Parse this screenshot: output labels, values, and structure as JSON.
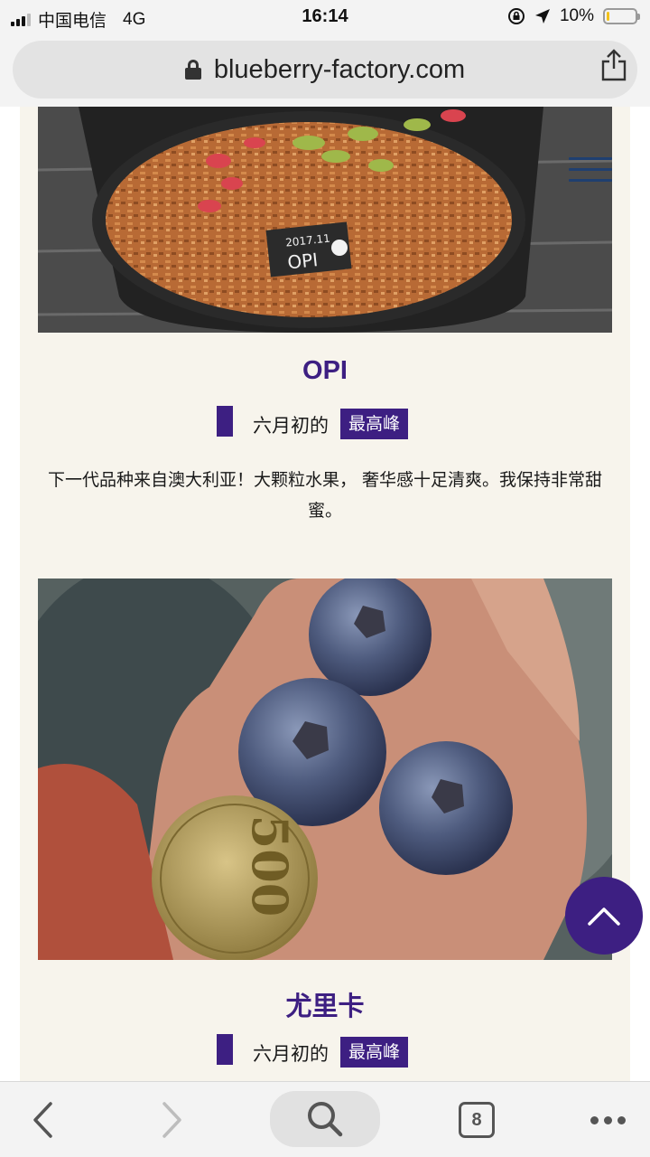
{
  "status_bar": {
    "carrier": "中国电信",
    "network": "4G",
    "time": "16:14",
    "battery_percent": "10%",
    "battery_level": 0.1
  },
  "browser": {
    "url": "blueberry-factory.com",
    "tab_count": "8"
  },
  "varieties": [
    {
      "name": "OPI",
      "label_text": "2017.11",
      "label_name": "OPI",
      "peak_prefix": "六月初的",
      "peak_badge": "最高峰",
      "description": "下一代品种来自澳大利亚！大颗粒水果， 奢华感十足清爽。我保持非常甜蜜。"
    },
    {
      "name": "尤里卡",
      "coin_value": "500",
      "peak_prefix": "六月初的",
      "peak_badge": "最高峰"
    }
  ],
  "colors": {
    "accent": "#3d1f82",
    "card_background": "#f7f4ec",
    "menu_icon": "#1f3f70"
  },
  "icons": {
    "menu": "hamburger-menu-icon",
    "scroll_top": "chevron-up-icon",
    "share": "share-icon",
    "lock": "lock-icon",
    "back": "chevron-left-icon",
    "forward": "chevron-right-icon",
    "search": "search-icon",
    "more": "more-dots-icon"
  }
}
